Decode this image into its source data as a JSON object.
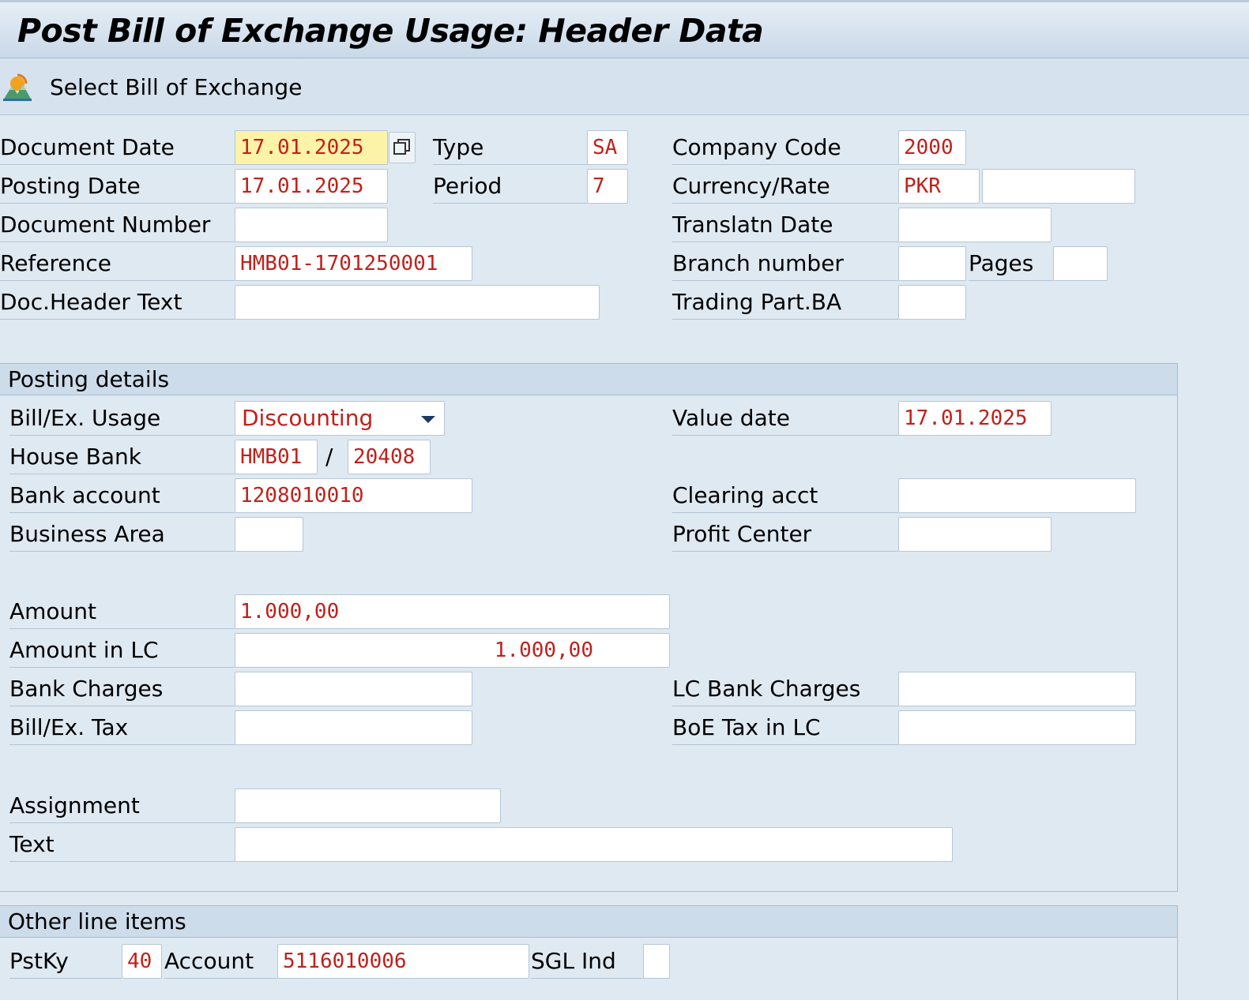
{
  "title": "Post Bill of Exchange Usage: Header Data",
  "toolbar": {
    "select_bill_label": "Select Bill of Exchange",
    "select_bill_icon": "mountain-sun-icon"
  },
  "header": {
    "document_date_label": "Document Date",
    "document_date": "17.01.2025",
    "type_label": "Type",
    "type": "SA",
    "company_code_label": "Company Code",
    "company_code": "2000",
    "posting_date_label": "Posting Date",
    "posting_date": "17.01.2025",
    "period_label": "Period",
    "period": "7",
    "currency_rate_label": "Currency/Rate",
    "currency": "PKR",
    "rate": "",
    "document_number_label": "Document Number",
    "document_number": "",
    "translatn_date_label": "Translatn Date",
    "translatn_date": "",
    "reference_label": "Reference",
    "reference": "HMB01-1701250001",
    "branch_number_label": "Branch number",
    "branch_number": "",
    "pages_label": "Pages",
    "pages": "",
    "doc_header_text_label": "Doc.Header Text",
    "doc_header_text": "",
    "trading_part_label": "Trading Part.BA",
    "trading_part": ""
  },
  "posting_details": {
    "group_title": "Posting details",
    "usage_label": "Bill/Ex. Usage",
    "usage": "Discounting",
    "value_date_label": "Value date",
    "value_date": "17.01.2025",
    "house_bank_label": "House Bank",
    "house_bank": "HMB01",
    "house_bank_sep": "/",
    "account_id": "20408",
    "bank_account_label": "Bank account",
    "bank_account": "1208010010",
    "clearing_acct_label": "Clearing acct",
    "clearing_acct": "",
    "business_area_label": "Business Area",
    "business_area": "",
    "profit_center_label": "Profit Center",
    "profit_center": "",
    "amount_label": "Amount",
    "amount": "1.000,00",
    "amount_lc_label": "Amount in LC",
    "amount_lc": "1.000,00",
    "bank_charges_label": "Bank Charges",
    "bank_charges": "",
    "lc_bank_charges_label": "LC Bank Charges",
    "lc_bank_charges": "",
    "tax_label": "Bill/Ex. Tax",
    "tax": "",
    "boe_tax_lc_label": "BoE Tax in LC",
    "boe_tax_lc": "",
    "assignment_label": "Assignment",
    "assignment": "",
    "text_label": "Text",
    "text": ""
  },
  "other_items": {
    "group_title": "Other line items",
    "pstky_label": "PstKy",
    "pstky": "40",
    "account_label": "Account",
    "account": "5116010006",
    "sgl_ind_label": "SGL Ind",
    "sgl_ind": ""
  }
}
